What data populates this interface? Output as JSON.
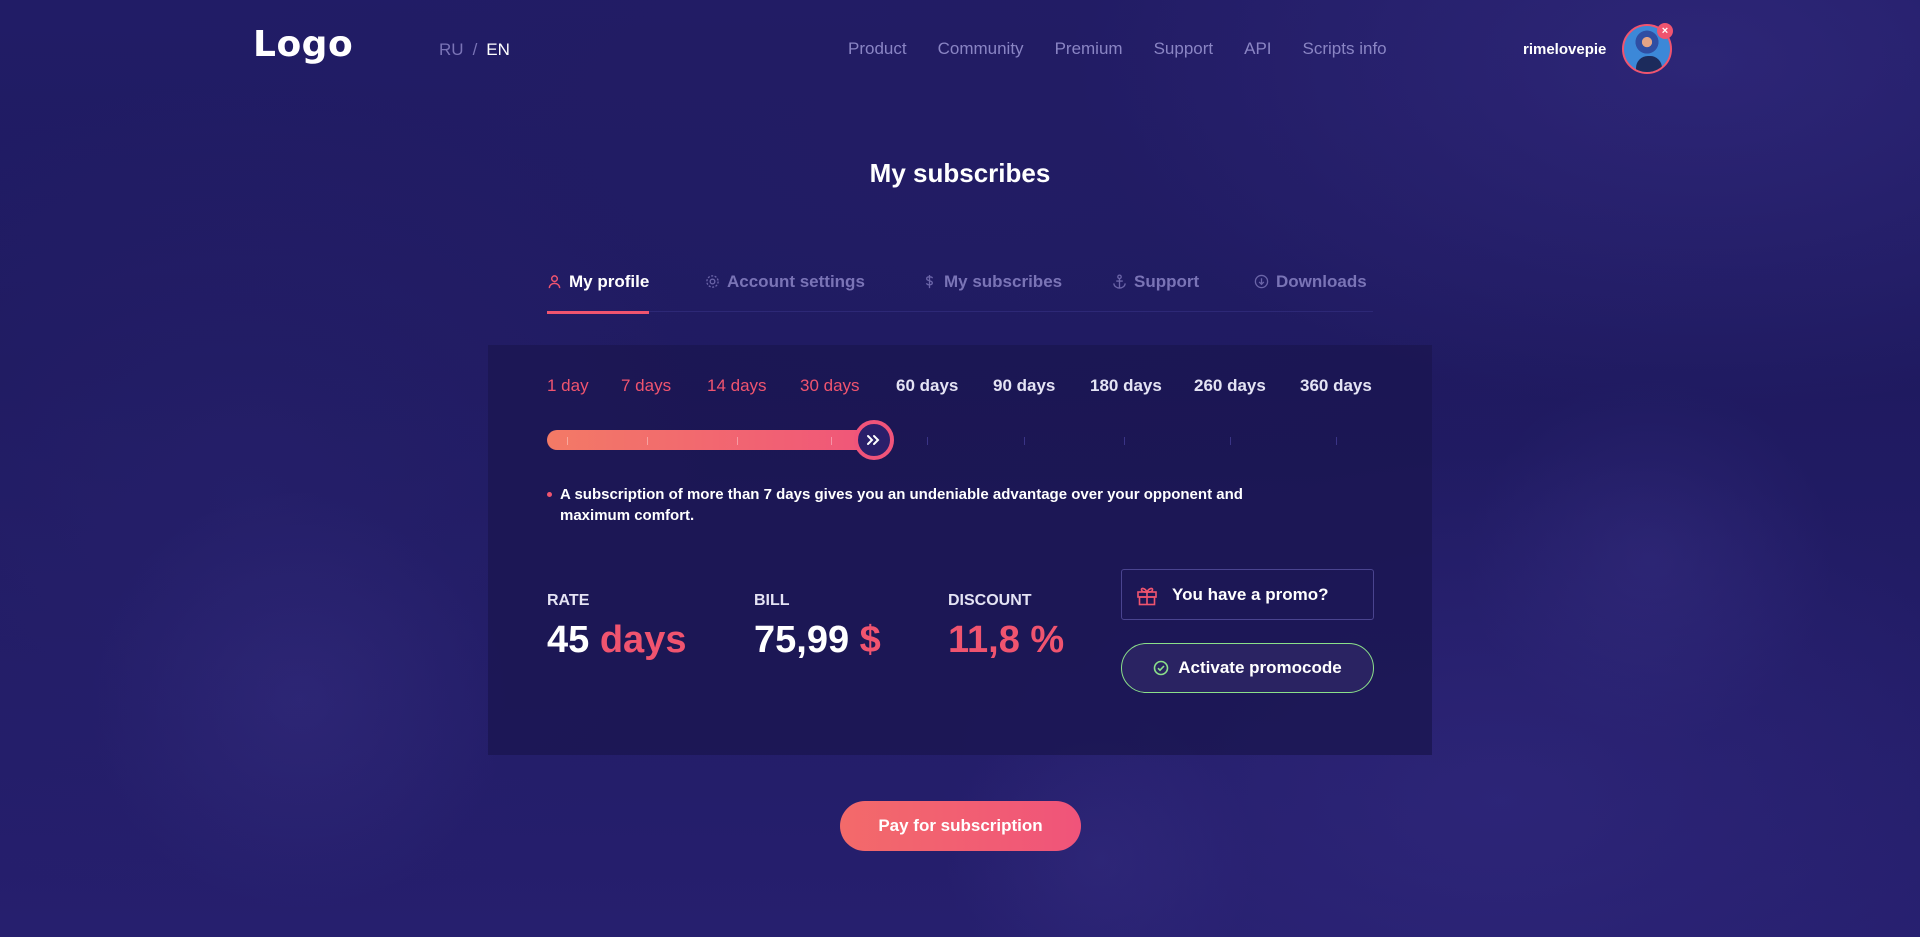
{
  "header": {
    "logo": "Logo",
    "lang": {
      "ru": "RU",
      "sep": "/",
      "en": "EN"
    },
    "nav": [
      "Product",
      "Community",
      "Premium",
      "Support",
      "API",
      "Scripts info"
    ],
    "username": "rimelovepie"
  },
  "page_title": "My subscribes",
  "tabs": [
    {
      "label": "My profile",
      "icon": "user-icon",
      "active": true
    },
    {
      "label": "Account settings",
      "icon": "gear-icon",
      "active": false
    },
    {
      "label": "My subscribes",
      "icon": "dollar-icon",
      "active": false
    },
    {
      "label": "Support",
      "icon": "anchor-icon",
      "active": false
    },
    {
      "label": "Downloads",
      "icon": "download-icon",
      "active": false
    }
  ],
  "durations": [
    {
      "label": "1 day",
      "selected": true
    },
    {
      "label": "7 days",
      "selected": true
    },
    {
      "label": "14 days",
      "selected": true
    },
    {
      "label": "30 days",
      "selected": true
    },
    {
      "label": "60 days",
      "selected": false
    },
    {
      "label": "90 days",
      "selected": false
    },
    {
      "label": "180 days",
      "selected": false
    },
    {
      "label": "260 days",
      "selected": false
    },
    {
      "label": "360 days",
      "selected": false
    }
  ],
  "slider": {
    "selected_index": 3
  },
  "note": "A subscription of more than 7 days gives you an undeniable advantage over your opponent and maximum comfort.",
  "stats": {
    "rate": {
      "label": "RATE",
      "value": "45",
      "unit": "days"
    },
    "bill": {
      "label": "BILL",
      "value": "75,99",
      "unit": "$"
    },
    "discount": {
      "label": "DISCOUNT",
      "value": "11,8 %"
    }
  },
  "promo": {
    "label": "You have a promo?"
  },
  "activate": {
    "label": "Activate promocode"
  },
  "pay": {
    "label": "Pay for subscription"
  },
  "colors": {
    "accent": "#f0546f",
    "background": "#1e1a5e",
    "success": "#8be08a"
  }
}
